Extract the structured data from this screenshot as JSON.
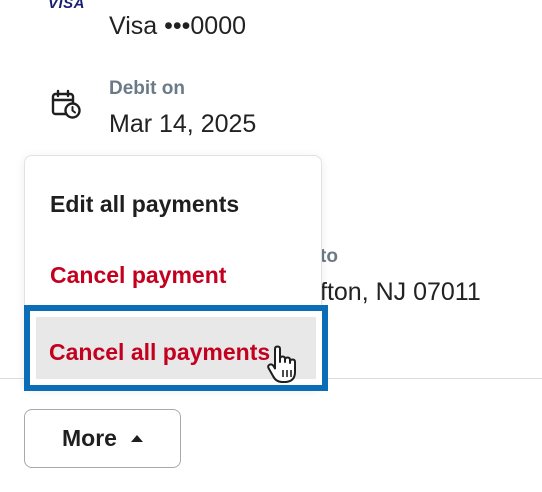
{
  "payment_method": {
    "logo": "VISA",
    "text": "Visa •••0000"
  },
  "debit": {
    "label": "Debit on",
    "value": "Mar 14, 2025"
  },
  "partial": {
    "label": "to",
    "value": "fton, NJ 07011"
  },
  "menu": {
    "items": [
      {
        "label": "Edit all payments",
        "icon": "none"
      },
      {
        "label": "Cancel payment",
        "icon": "none"
      },
      {
        "label": "Cancel all payments",
        "icon": "none"
      }
    ]
  },
  "more_button": {
    "label": "More",
    "icon": "caret-up-icon"
  },
  "colors": {
    "danger": "#c4001f",
    "focus_ring": "#0a6db5",
    "muted_label": "#6b7a87",
    "hover_bg": "#e8e8e8"
  }
}
